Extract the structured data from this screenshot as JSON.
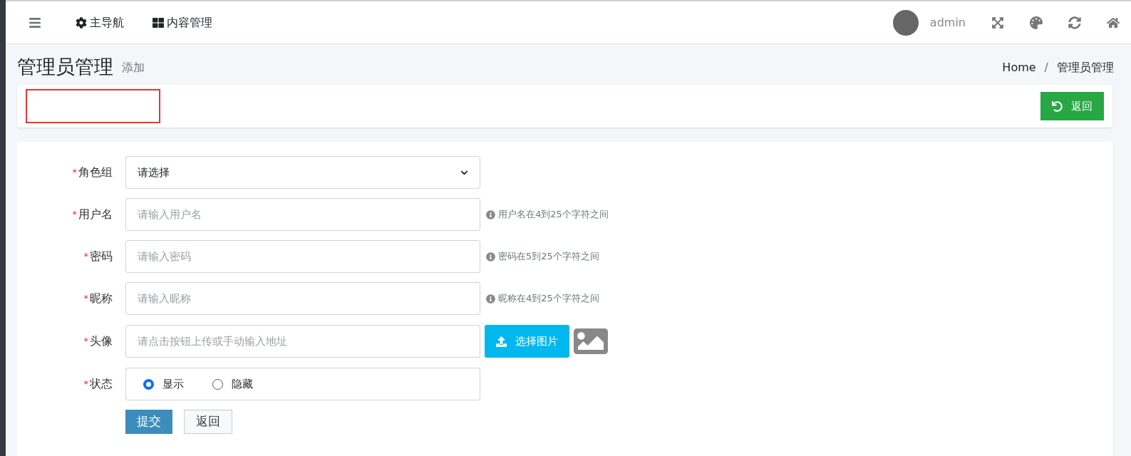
{
  "navbar": {
    "items": [
      {
        "kind": "menu"
      },
      {
        "kind": "gear",
        "label": "主导航"
      },
      {
        "kind": "grid",
        "label": "内容管理"
      }
    ],
    "user": "admin"
  },
  "header": {
    "title": "管理员管理",
    "subtitle": "添加",
    "breadcrumb": [
      "Home",
      "管理员管理"
    ],
    "separator": "/"
  },
  "toolbar": {
    "back_button": "返回"
  },
  "form": {
    "fields": [
      {
        "kind": "select",
        "label": "角色组",
        "marker": "*",
        "value": "请选择"
      },
      {
        "kind": "text",
        "label": "用户名",
        "marker": "*",
        "placeholder": "请输入用户名",
        "hint": "用户名在4到25个字符之间"
      },
      {
        "kind": "text",
        "label": "密码",
        "marker": "*",
        "placeholder": "请输入密码",
        "hint": "密码在5到25个字符之间"
      },
      {
        "kind": "text",
        "label": "昵称",
        "marker": "*",
        "placeholder": "请输入昵称",
        "hint": "昵称在4到25个字符之间"
      },
      {
        "kind": "upload",
        "label": "头像",
        "marker": "*",
        "placeholder": "请点击按钮上传或手动输入地址",
        "button": "选择图片"
      },
      {
        "kind": "radio",
        "label": "状态",
        "marker": "*",
        "options": [
          {
            "label": "显示",
            "selected": true
          },
          {
            "label": "隐藏",
            "selected": false
          }
        ]
      }
    ],
    "buttons": [
      {
        "kind": "primary",
        "label": "提交"
      },
      {
        "kind": "default",
        "label": "返回"
      }
    ]
  }
}
